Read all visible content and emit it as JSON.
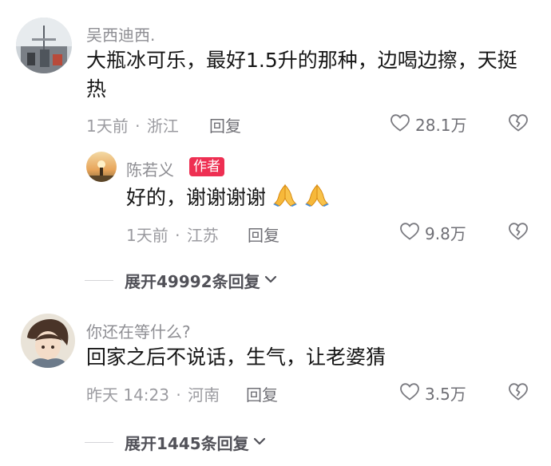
{
  "comments": [
    {
      "username": "吴西迪西.",
      "text": "大瓶冰可乐，最好1.5升的那种，边喝边擦，天挺热",
      "time": "1天前",
      "sep": "·",
      "location": "浙江",
      "reply_label": "回复",
      "likes": "28.1万",
      "avatar_icon": "avatar-photo-city",
      "replies": [
        {
          "username": "陈若义",
          "badge": "作者",
          "text": "好的，谢谢谢谢",
          "emoji": [
            "folded-hands-icon",
            "folded-hands-icon"
          ],
          "time": "1天前",
          "sep": "·",
          "location": "江苏",
          "reply_label": "回复",
          "likes": "9.8万",
          "avatar_icon": "avatar-photo-sunset"
        }
      ],
      "expand_label": "展开49992条回复"
    },
    {
      "username": "你还在等什么?",
      "text": "回家之后不说话，生气，让老婆猜",
      "time": "昨天 14:23",
      "sep": "·",
      "location": "河南",
      "reply_label": "回复",
      "likes": "3.5万",
      "avatar_icon": "avatar-anime-character",
      "expand_label": "展开1445条回复"
    }
  ],
  "colors": {
    "badge": "#ee2f52",
    "meta": "#9b9ba0",
    "name": "#8e8e93",
    "text": "#161616"
  }
}
